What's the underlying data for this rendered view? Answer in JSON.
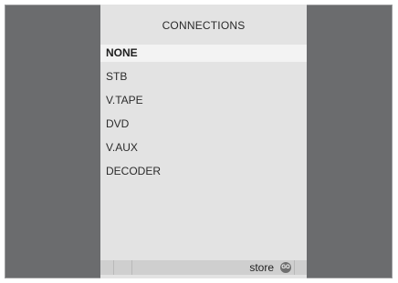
{
  "menu": {
    "title": "CONNECTIONS",
    "items": [
      {
        "label": "NONE"
      },
      {
        "label": "STB"
      },
      {
        "label": "V.TAPE"
      },
      {
        "label": "DVD"
      },
      {
        "label": "V.AUX"
      },
      {
        "label": "DECODER"
      }
    ],
    "selected_index": 0
  },
  "statusbar": {
    "store_label": "store",
    "go_icon_text": "GO",
    "go_icon": "go-button-icon"
  },
  "colors": {
    "background": "#6b6c6e",
    "panel": "#e3e3e3",
    "highlight": "#f3f3f3"
  }
}
